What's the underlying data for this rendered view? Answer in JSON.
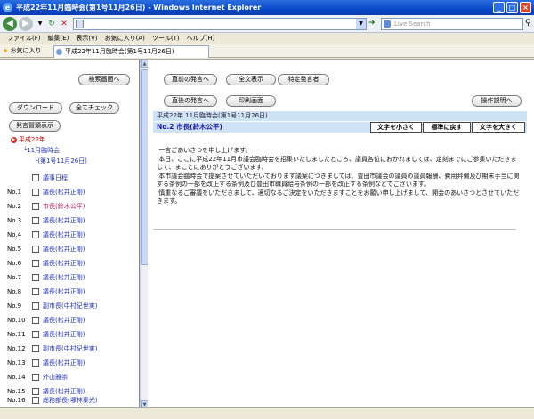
{
  "window": {
    "title": "平成22年11月臨時会(第1号11月26日) - Windows Internet Explorer"
  },
  "navbar": {
    "address": "",
    "search_placeholder": "Live Search"
  },
  "menu": [
    "ファイル(F)",
    "編集(E)",
    "表示(V)",
    "お気に入り(A)",
    "ツール(T)",
    "ヘルプ(H)"
  ],
  "favorites": {
    "label": "お気に入り",
    "tab_title": "平成22年11月臨時会(第1号11月26日)"
  },
  "left": {
    "search_button": "検索画面へ",
    "download_button": "ダウンロード",
    "check_all_button": "全てチェック",
    "speaker_list_button": "発言冒頭表示",
    "tree_year": "平成22年",
    "tree_session": "11月臨時会",
    "tree_day": "(第1号11月26日)",
    "agenda_label": "議事日程",
    "items": [
      {
        "no": "No.1",
        "label": "議長(松井正剛)",
        "red": false
      },
      {
        "no": "No.2",
        "label": "市長(鈴木公平)",
        "red": true
      },
      {
        "no": "No.3",
        "label": "議長(松井正剛)",
        "red": false
      },
      {
        "no": "No.4",
        "label": "議長(松井正剛)",
        "red": false
      },
      {
        "no": "No.5",
        "label": "議長(松井正剛)",
        "red": false
      },
      {
        "no": "No.6",
        "label": "議長(松井正剛)",
        "red": false
      },
      {
        "no": "No.7",
        "label": "議長(松井正剛)",
        "red": false
      },
      {
        "no": "No.8",
        "label": "議長(松井正剛)",
        "red": false
      },
      {
        "no": "No.9",
        "label": "副市長(中村紀世実)",
        "red": false
      },
      {
        "no": "No.10",
        "label": "議長(松井正剛)",
        "red": false
      },
      {
        "no": "No.11",
        "label": "議長(松井正剛)",
        "red": false
      },
      {
        "no": "No.12",
        "label": "副市長(中村紀世実)",
        "red": false
      },
      {
        "no": "No.13",
        "label": "議長(松井正剛)",
        "red": false
      },
      {
        "no": "No.14",
        "label": "外山雅崇",
        "red": false
      },
      {
        "no": "No.15",
        "label": "議長(松井正剛)",
        "red": false
      },
      {
        "no": "No.16",
        "label": "総務部長(塚林秦光)",
        "red": false
      }
    ]
  },
  "right": {
    "prev_button": "直前の発言へ",
    "full_button": "全文表示",
    "specific_button": "特定発言者",
    "next_button": "直後の発言へ",
    "print_button": "印刷画面",
    "help_button": "操作説明へ",
    "session_header": "平成22年 11月臨時会(第1号11月26日)",
    "speaker_header": "No.2 市長(鈴木公平)",
    "font_smaller": "文字を小さく",
    "font_normal": "標準に戻す",
    "font_larger": "文字を大きく",
    "body": " 一言ごあいさつを申し上げます。\n 本日、ここに平成22年11月市議会臨時会を招集いたしましたところ、議員各位におかれましては、定刻までにご参集いただきまして、まことにありがとうございます。\n 本市議会臨時会で提案させていただいております議案につきましては、豊田市議会の議員の議員報酬、費用弁償及び期末手当に関する条例の一部を改正する条例及び豊田市職員給与条例の一部を改正する条例などでございます。\n 慎重なるご審議をいただきまして、適切なるご決定をいただきますことをお願い申し上げまして、開会のあいさつとさせていただきます。"
  }
}
